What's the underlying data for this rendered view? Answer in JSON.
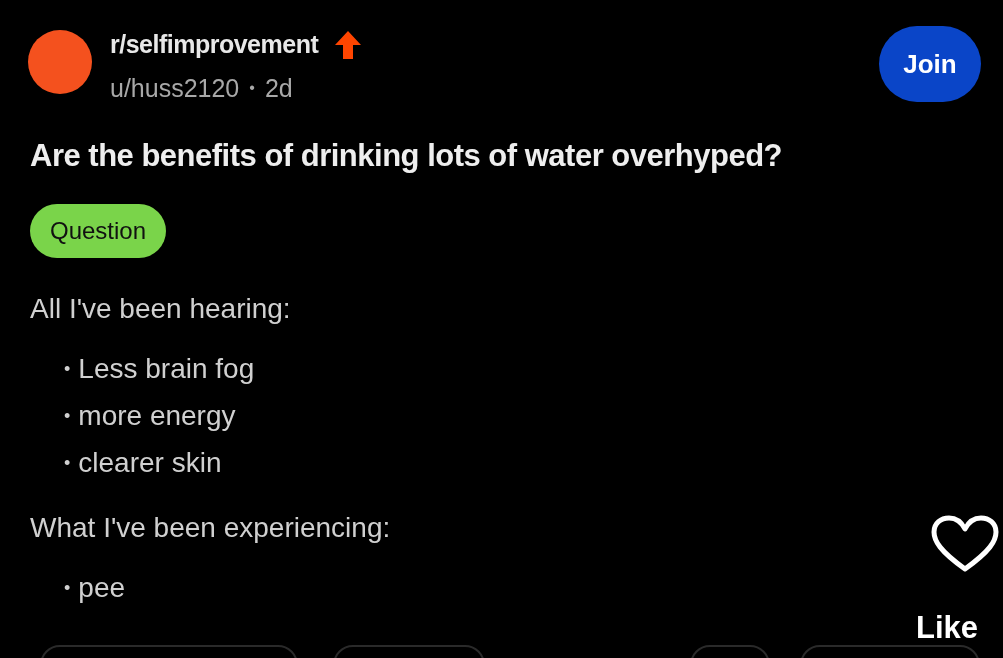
{
  "post": {
    "subreddit": "r/selfimprovement",
    "author": "u/huss2120",
    "separator": "•",
    "age": "2d",
    "join_label": "Join",
    "title": "Are the benefits of drinking lots of water overhyped?",
    "flair": "Question",
    "body": [
      {
        "kind": "paragraph",
        "text": "All I've been hearing:"
      },
      {
        "kind": "list",
        "items": [
          {
            "marker": "•",
            "text": "Less brain fog"
          },
          {
            "marker": "•",
            "text": "more energy"
          },
          {
            "marker": "•",
            "text": "clearer skin"
          }
        ]
      },
      {
        "kind": "paragraph",
        "text": "What I've been experiencing:"
      },
      {
        "kind": "list",
        "items": [
          {
            "marker": "•",
            "text": "pee"
          }
        ]
      }
    ]
  },
  "side": {
    "like_label": "Like",
    "liked": false
  }
}
